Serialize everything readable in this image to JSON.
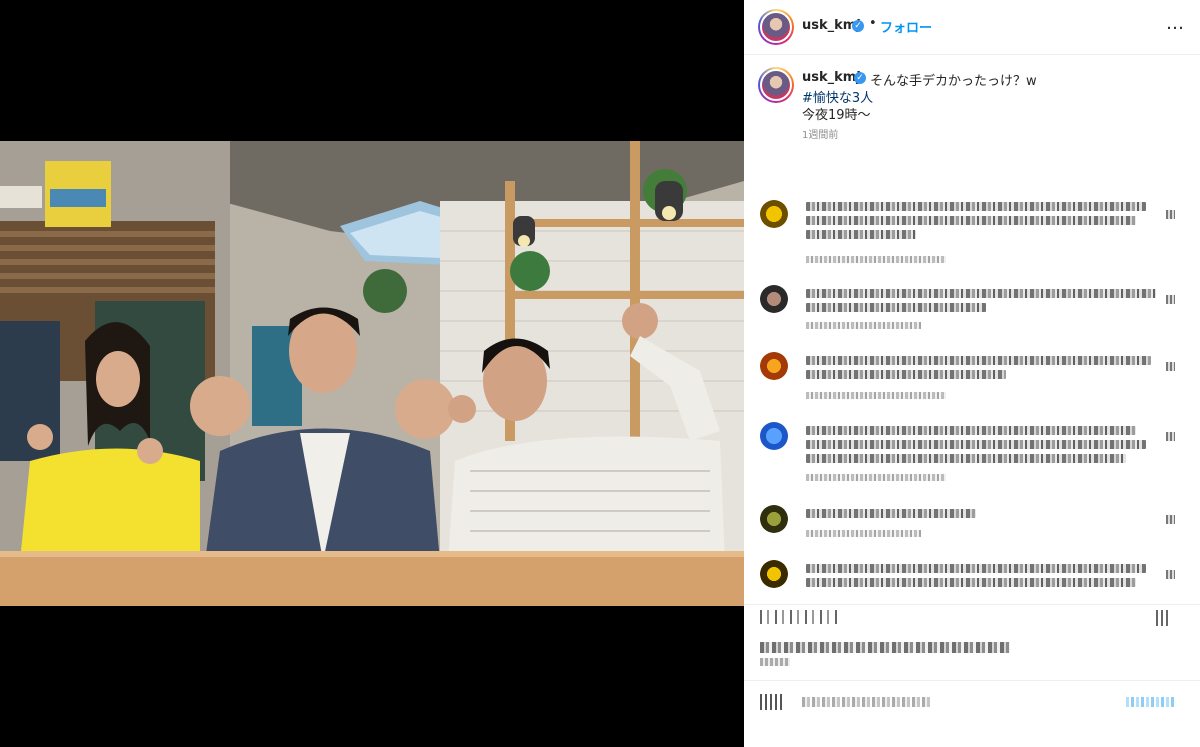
{
  "post": {
    "username": "usk_kmj",
    "verified_glyph": "✓",
    "separator": "•",
    "follow_label": "フォロー",
    "more_icon": "…",
    "caption": {
      "text": "そんな手デカかったっけ？w",
      "hashtag": "#愉快な3人",
      "line2": "今夜19時〜",
      "time": "1週間前"
    }
  },
  "icons": {
    "more": "more-options-icon",
    "verified": "verified-badge-icon",
    "like": "heart-icon",
    "comment": "comment-icon",
    "share": "share-icon",
    "save": "bookmark-icon",
    "emoji": "emoji-icon"
  },
  "colors": {
    "accent": "#0095f6",
    "hashtag": "#00376b",
    "verified": "#3897f0",
    "muted": "#8e8e8e"
  }
}
